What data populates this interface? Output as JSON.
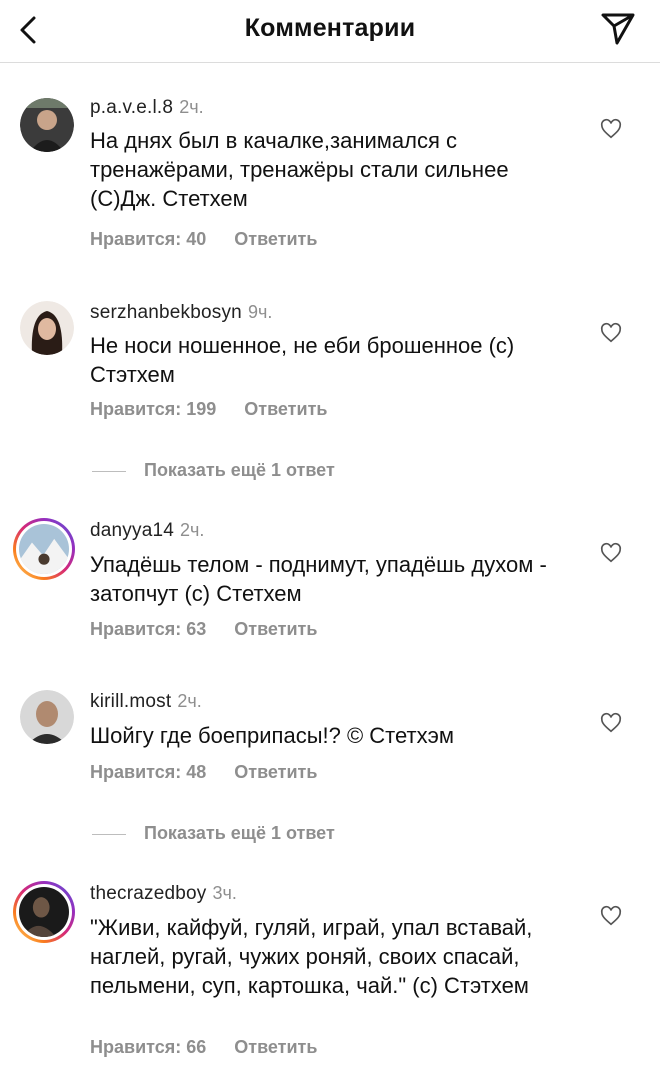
{
  "header": {
    "title": "Комментарии"
  },
  "comments": [
    {
      "username": "p.a.v.e.l.8",
      "time": "2ч.",
      "text": "На днях был в качалке,занимался с тренажёрами, тренажёры стали сильнее (С)Дж. Стетхем",
      "likes": "Нравится: 40",
      "reply": "Ответить"
    },
    {
      "username": "serzhanbekbosyn",
      "time": "9ч.",
      "text": "Не носи ношенное, не еби брошенное (с) Стэтхем",
      "likes": "Нравится: 199",
      "reply": "Ответить"
    },
    {
      "username": "danyya14",
      "time": "2ч.",
      "text": "Упадёшь телом - поднимут, упадёшь духом - затопчут (с) Стетхем",
      "likes": "Нравится: 63",
      "reply": "Ответить"
    },
    {
      "username": "kirill.most",
      "time": "2ч.",
      "text": "Шойгу где боеприпасы!? © Стетхэм",
      "likes": "Нравится: 48",
      "reply": "Ответить"
    },
    {
      "username": "thecrazedboy",
      "time": "3ч.",
      "text": "\"Живи, кайфуй, гуляй, играй, упал вставай, наглей, ругай, чужих роняй, своих спасай, пельмени, суп, картошка, чай.\" (с) Стэтхем",
      "likes": "Нравится: 66",
      "reply": "Ответить"
    }
  ],
  "show_more": [
    "Показать ещё 1 ответ",
    "Показать ещё 1 ответ"
  ]
}
